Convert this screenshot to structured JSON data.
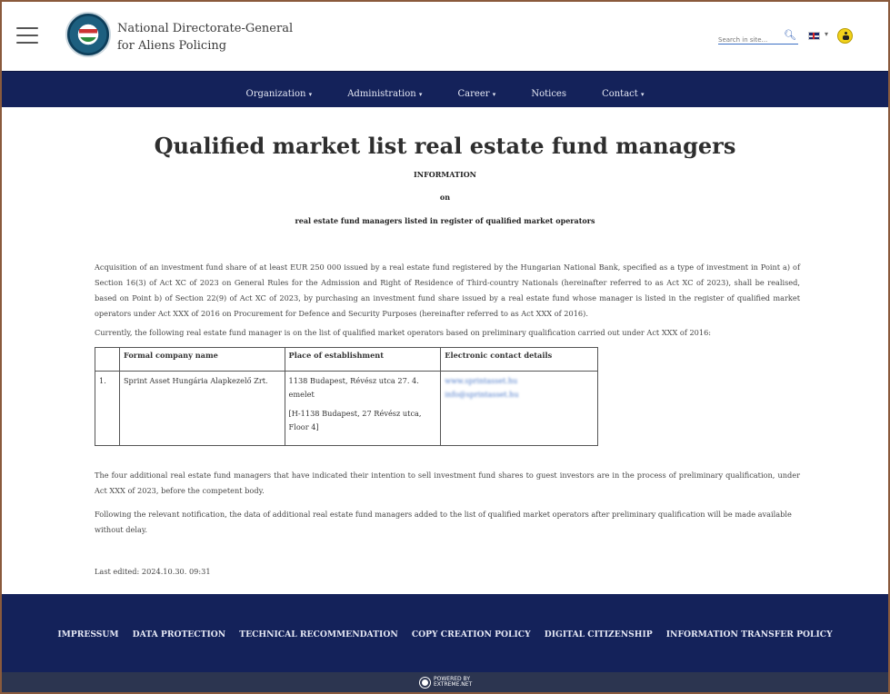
{
  "header": {
    "org_line1": "National Directorate-General",
    "org_line2": "for Aliens Policing",
    "search_placeholder": "Search in site...",
    "language": "EN"
  },
  "nav": {
    "items": [
      {
        "label": "Organization",
        "dropdown": true
      },
      {
        "label": "Administration",
        "dropdown": true
      },
      {
        "label": "Career",
        "dropdown": true
      },
      {
        "label": "Notices",
        "dropdown": false
      },
      {
        "label": "Contact",
        "dropdown": true
      }
    ]
  },
  "main": {
    "title": "Qualified market list real estate fund managers",
    "info_label": "INFORMATION",
    "on_label": "on",
    "subtitle": "real estate fund managers listed in register of qualified market operators",
    "paragraph1": "Acquisition of an investment fund share of at least EUR 250 000 issued by a real estate fund registered by the Hungarian National Bank, specified as a type of investment in Point a) of Section 16(3) of Act XC of 2023 on General Rules for the Admission and Right of Residence of Third-country Nationals (hereinafter referred to as Act XC of 2023), shall be realised, based on Point b) of Section 22(9) of Act XC of 2023, by purchasing an investment fund share issued by a real estate fund whose manager is listed in the register of qualified market operators under Act XXX of 2016 on Procurement for Defence and Security Purposes (hereinafter referred to as Act XXX of 2016).",
    "paragraph2": "Currently, the following real estate fund manager is on the list of qualified market operators based on preliminary qualification carried out under Act XXX of 2016:",
    "table": {
      "headers": [
        "",
        "Formal company name",
        "Place of establishment",
        "Electronic contact details"
      ],
      "rows": [
        {
          "num": "1.",
          "company": "Sprint Asset Hungária Alapkezelő Zrt.",
          "place_hu": "1138 Budapest, Révész utca 27. 4. emelet",
          "place_en": "[H-1138 Budapest, 27 Révész utca, Floor 4]",
          "contact_web": "www.sprintasset.hu",
          "contact_email": "info@sprintasset.hu"
        }
      ]
    },
    "paragraph3": "The four additional real estate fund managers that have indicated their intention to sell investment fund shares to guest investors are in the process of preliminary qualification, under Act XXX of 2023, before the competent body.",
    "paragraph4": "Following the relevant notification, the data of additional real estate fund managers added to the list of qualified market operators after preliminary qualification will be made available without delay.",
    "last_edited": "Last edited: 2024.10.30. 09:31"
  },
  "footer": {
    "links": [
      "IMPRESSUM",
      "DATA PROTECTION",
      "TECHNICAL RECOMMENDATION",
      "COPY CREATION POLICY",
      "DIGITAL CITIZENSHIP",
      "INFORMATION TRANSFER POLICY"
    ],
    "powered_by": "POWERED BY EXTREME.NET"
  },
  "colors": {
    "nav_bg": "#14225a",
    "frame_border": "#8a5a3c",
    "link": "#4a78c9"
  }
}
